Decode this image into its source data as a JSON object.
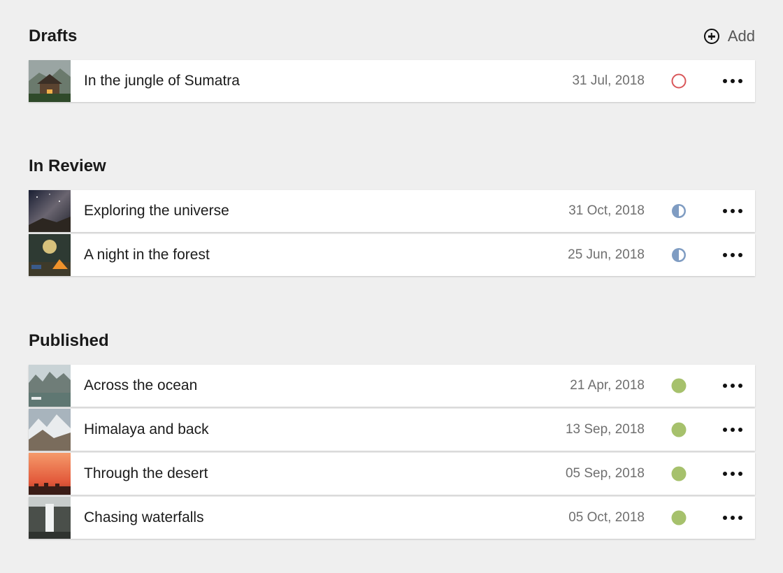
{
  "add_label": "Add",
  "status_colors": {
    "draft": "#d9575a",
    "review": "#7f9cc2",
    "published": "#a6c16c"
  },
  "sections": [
    {
      "title": "Drafts",
      "items": [
        {
          "title": "In the jungle of Sumatra",
          "date": "31 Jul, 2018",
          "status": "draft"
        }
      ]
    },
    {
      "title": "In Review",
      "items": [
        {
          "title": "Exploring the universe",
          "date": "31 Oct, 2018",
          "status": "review"
        },
        {
          "title": "A night in the forest",
          "date": "25 Jun, 2018",
          "status": "review"
        }
      ]
    },
    {
      "title": "Published",
      "items": [
        {
          "title": "Across the ocean",
          "date": "21 Apr, 2018",
          "status": "published"
        },
        {
          "title": "Himalaya and back",
          "date": "13 Sep, 2018",
          "status": "published"
        },
        {
          "title": "Through the desert",
          "date": "05 Sep, 2018",
          "status": "published"
        },
        {
          "title": "Chasing waterfalls",
          "date": "05 Oct, 2018",
          "status": "published"
        }
      ]
    }
  ]
}
